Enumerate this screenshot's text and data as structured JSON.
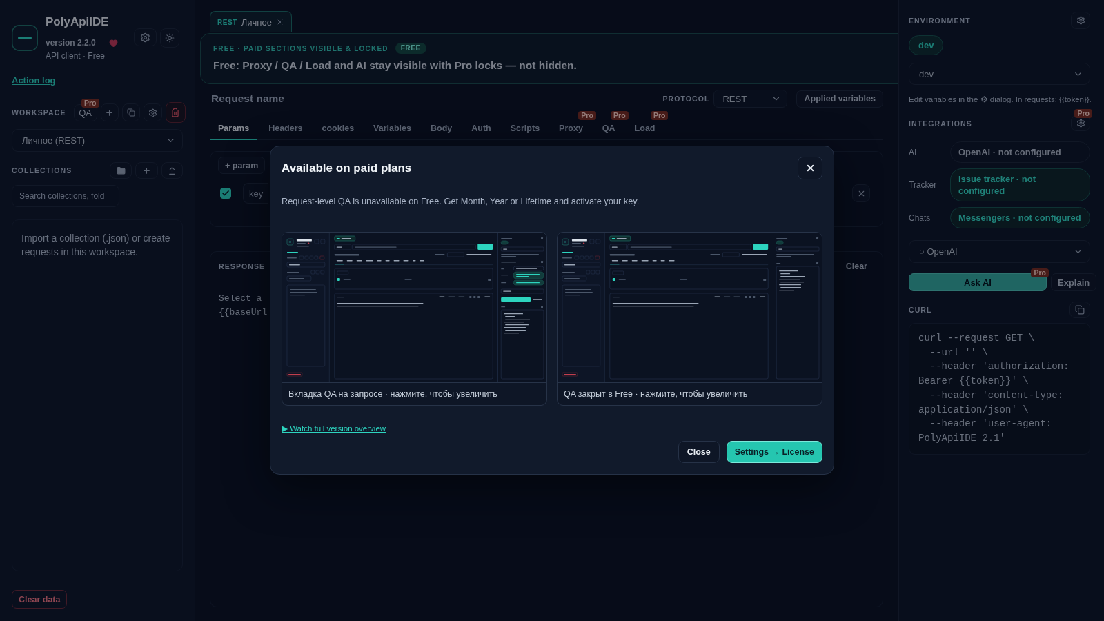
{
  "app": {
    "name": "PolyApiIDE",
    "version": "version 2.2.0",
    "plan": "API client · Free"
  },
  "sidebar": {
    "action_log": "Action log",
    "workspace": {
      "label": "WORKSPACE",
      "mode": "QA",
      "mode_badge": "Pro",
      "selected": "Личное (REST)"
    },
    "collections": {
      "label": "COLLECTIONS",
      "search_placeholder": "Search collections, fold",
      "empty_text": "Import a collection (.json) or create requests in this workspace."
    },
    "clear_data": "Clear data"
  },
  "request_tabs": [
    {
      "protocol": "REST",
      "name": "Личное",
      "selected": true
    }
  ],
  "banner": {
    "eyebrow": "FREE · PAID SECTIONS VISIBLE & LOCKED",
    "badge": "FREE",
    "message": "Free: Proxy / QA / Load and AI stay visible with Pro locks — not hidden."
  },
  "request": {
    "name_placeholder": "Request name",
    "protocol_label": "PROTOCOL",
    "protocol": "REST",
    "applied_variables": "Applied variables"
  },
  "section_tabs": [
    {
      "label": "Params",
      "selected": true
    },
    {
      "label": "Headers",
      "selected": false
    },
    {
      "label": "cookies",
      "selected": false
    },
    {
      "label": "Variables",
      "selected": false
    },
    {
      "label": "Body",
      "selected": false
    },
    {
      "label": "Auth",
      "selected": false
    },
    {
      "label": "Scripts",
      "selected": false
    },
    {
      "label": "Proxy",
      "selected": false,
      "badge": "Pro"
    },
    {
      "label": "QA",
      "selected": false,
      "badge": "Pro"
    },
    {
      "label": "Load",
      "selected": false,
      "badge": "Pro"
    }
  ],
  "params": {
    "add_button": "+ param",
    "rows": [
      {
        "enabled": true,
        "key_placeholder": "key"
      }
    ]
  },
  "response": {
    "label": "RESPONSE",
    "clear": "Clear",
    "lines": [
      "Select a",
      "{{baseUrl"
    ]
  },
  "environment": {
    "label": "ENVIRONMENT",
    "active": "dev",
    "selected": "dev",
    "hint": "Edit variables in the ⚙ dialog. In requests: {{token}}."
  },
  "integrations": {
    "label": "INTEGRATIONS",
    "badge": "Pro",
    "rows": [
      {
        "label": "AI",
        "value": "OpenAI · not configured",
        "kind": "neutral"
      },
      {
        "label": "Tracker",
        "value": "Issue tracker · not configured",
        "kind": "accent"
      },
      {
        "label": "Chats",
        "value": "Messengers · not configured",
        "kind": "accent"
      }
    ]
  },
  "assistant": {
    "provider": "○ OpenAI",
    "ask": {
      "label": "Ask AI",
      "badge": "Pro",
      "disabled": true
    },
    "explain": "Explain"
  },
  "curl": {
    "label": "CURL",
    "lines": [
      "curl --request GET \\",
      "  --url '' \\",
      "  --header 'authorization: Bearer {{token}}' \\",
      "  --header 'content-type: application/json' \\",
      "  --header 'user-agent: PolyApiIDE 2.1'"
    ]
  },
  "modal": {
    "title": "Available on paid plans",
    "description": "Request-level QA is unavailable on Free. Get Month, Year or Lifetime and activate your key.",
    "previews": [
      {
        "kind": "pro",
        "caption": "Вкладка QA на запросе · нажмите, чтобы увеличить"
      },
      {
        "kind": "free",
        "caption": "QA закрыт в Free · нажмите, чтобы увеличить"
      }
    ],
    "link": "▶ Watch full version overview",
    "buttons": [
      {
        "label": "Close",
        "kind": "secondary"
      },
      {
        "label": "Settings → License",
        "kind": "primary"
      }
    ]
  }
}
